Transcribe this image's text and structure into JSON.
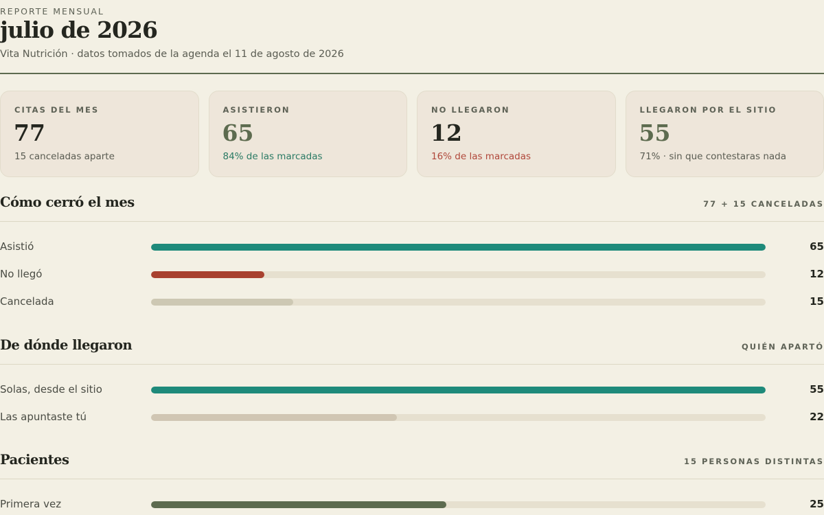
{
  "header": {
    "eyebrow": "REPORTE MENSUAL",
    "title": "julio de 2026",
    "subtitle": "Vita Nutrición · datos tomados de la agenda el 11 de agosto de 2026"
  },
  "cards": [
    {
      "label": "CITAS DEL MES",
      "value": "77",
      "note": "15 canceladas aparte",
      "value_color": "#24261f",
      "note_color": "#5a5c52"
    },
    {
      "label": "ASISTIERON",
      "value": "65",
      "note": "84% de las marcadas",
      "value_color": "#5d6b4f",
      "note_color": "#2a7a64"
    },
    {
      "label": "NO LLEGARON",
      "value": "12",
      "note": "16% de las marcadas",
      "value_color": "#24261f",
      "note_color": "#b0473a"
    },
    {
      "label": "LLEGARON POR EL SITIO",
      "value": "55",
      "note": "71% · sin que contestaras nada",
      "value_color": "#5d6b4f",
      "note_color": "#5a5c52"
    }
  ],
  "sections": [
    {
      "title": "Cómo cerró el mes",
      "meta": "77 + 15 CANCELADAS",
      "scale_max": 65,
      "rows": [
        {
          "label": "Asistió",
          "value": 65,
          "color": "#1e8a7a"
        },
        {
          "label": "No llegó",
          "value": 12,
          "color": "#a8412f"
        },
        {
          "label": "Cancelada",
          "value": 15,
          "color": "#cdc8b3"
        }
      ]
    },
    {
      "title": "De dónde llegaron",
      "meta": "QUIÉN APARTÓ",
      "scale_max": 55,
      "rows": [
        {
          "label": "Solas, desde el sitio",
          "value": 55,
          "color": "#1e8a7a"
        },
        {
          "label": "Las apuntaste tú",
          "value": 22,
          "color": "#d0c6b3"
        }
      ]
    },
    {
      "title": "Pacientes",
      "meta": "15 PERSONAS DISTINTAS",
      "scale_max": 52,
      "rows": [
        {
          "label": "Primera vez",
          "value": 25,
          "color": "#5d6b4f"
        }
      ]
    }
  ]
}
